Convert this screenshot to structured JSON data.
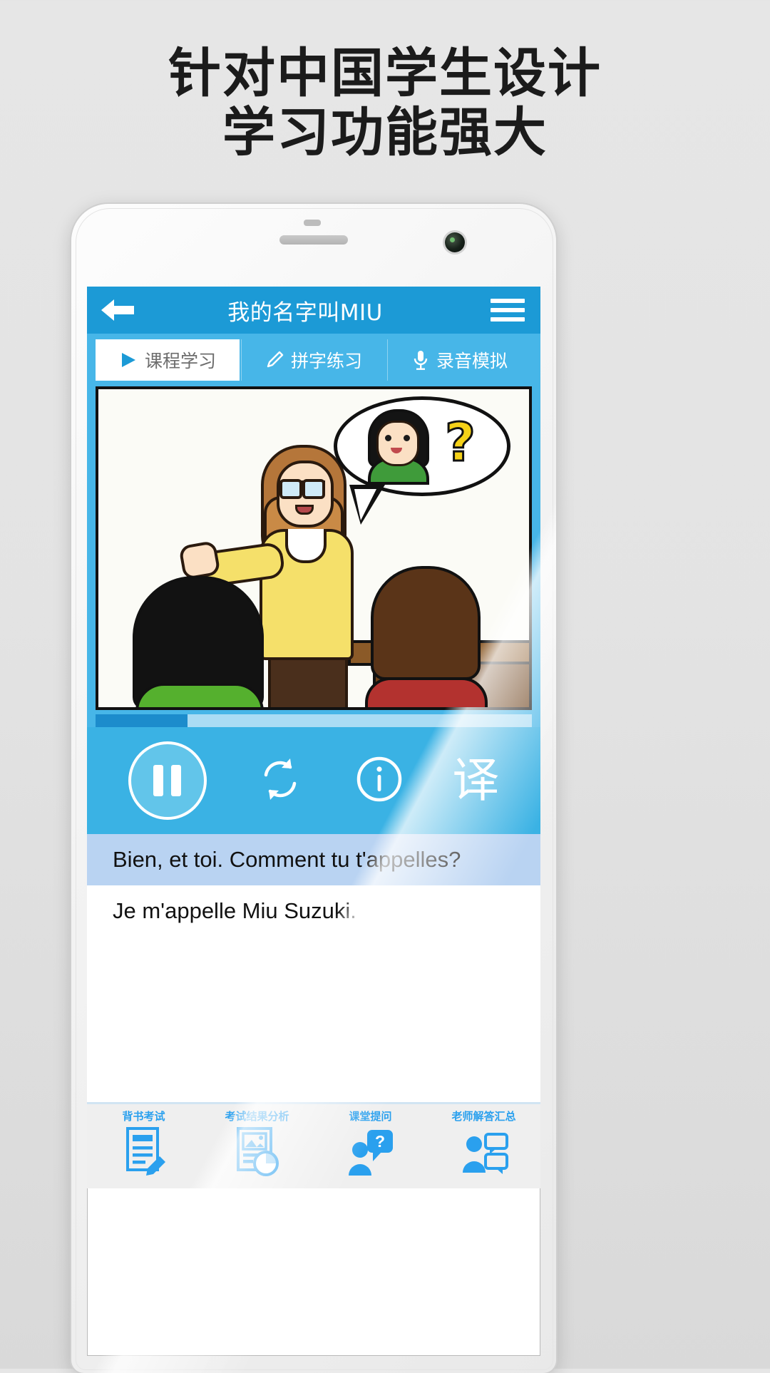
{
  "promo": {
    "headline_line1": "针对中国学生设计",
    "headline_line2": "学习功能强大"
  },
  "app": {
    "appbar": {
      "back_icon": "arrow-left-icon",
      "title": "我的名字叫MIU",
      "menu_icon": "hamburger-menu-icon"
    },
    "tabs": [
      {
        "label": "课程学习",
        "icon": "play-triangle-icon",
        "active": true
      },
      {
        "label": "拼字练习",
        "icon": "pencil-icon",
        "active": false
      },
      {
        "label": "录音模拟",
        "icon": "microphone-icon",
        "active": false
      }
    ],
    "player": {
      "progress_percent": 21,
      "controls": [
        {
          "name": "pause-button",
          "icon": "pause-icon"
        },
        {
          "name": "repeat-button",
          "icon": "loop-repeat-icon"
        },
        {
          "name": "info-button",
          "icon": "info-circle-icon"
        },
        {
          "name": "translate-button",
          "icon": "translate-char",
          "label": "译"
        }
      ]
    },
    "subtitles": {
      "current": "Bien, et toi. Comment tu t'appelles?",
      "next": "Je m'appelle Miu Suzuki."
    },
    "bottom_toolbar": [
      {
        "label": "背书考试",
        "icon": "document-pencil-icon"
      },
      {
        "label": "考试结果分析",
        "icon": "report-chart-icon"
      },
      {
        "label": "课堂提问",
        "icon": "person-question-icon"
      },
      {
        "label": "老师解答汇总",
        "icon": "teacher-answer-icon"
      }
    ]
  },
  "colors": {
    "appbar_blue": "#1c9ad6",
    "tab_blue": "#47b6e8",
    "controls_blue": "#3ab2e4",
    "subtitle_blue": "#b9d3f2",
    "icon_blue": "#2aa0ee",
    "progress_fill": "#1c8ccc"
  }
}
